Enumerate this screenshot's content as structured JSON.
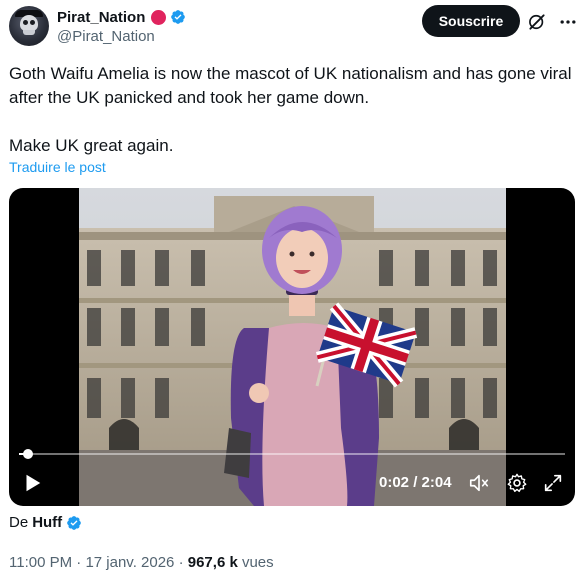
{
  "account": {
    "display_name": "Pirat_Nation",
    "handle": "@Pirat_Nation"
  },
  "header": {
    "subscribe_label": "Souscrire"
  },
  "post": {
    "line1": "Goth Waifu Amelia is now the mascot of UK nationalism and has gone viral after the UK panicked and took her game down.",
    "line2": "Make UK great again.",
    "translate_label": "Traduire le post"
  },
  "video": {
    "time_display": "0:02 / 2:04",
    "progress": 0.016
  },
  "source": {
    "prefix": "De",
    "author": "Huff"
  },
  "meta": {
    "time": "11:00 PM",
    "separator1": "·",
    "date": "17 janv. 2026",
    "separator2": "·",
    "views": "967,6 k",
    "views_suffix": "vues"
  },
  "colors": {
    "accent": "#1d9bf0",
    "badge_red": "#e0245e",
    "text": "#0f1419",
    "muted": "#536471"
  },
  "icons": [
    "verified-badge-icon",
    "grok-icon",
    "more-icon",
    "play-icon",
    "mute-icon",
    "settings-icon",
    "fullscreen-icon"
  ]
}
